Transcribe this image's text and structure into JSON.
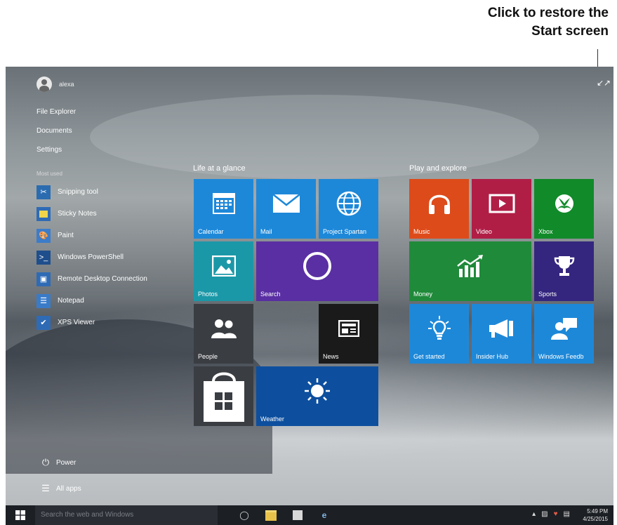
{
  "annotation": {
    "line1": "Click to restore the",
    "line2": "Start screen"
  },
  "user": {
    "name": "alexa"
  },
  "places": [
    {
      "label": "File Explorer"
    },
    {
      "label": "Documents"
    },
    {
      "label": "Settings"
    }
  ],
  "most_used_label": "Most used",
  "apps": [
    {
      "label": "Snipping tool",
      "icon": "scissors-icon",
      "color": "#2b6cb0"
    },
    {
      "label": "Sticky Notes",
      "icon": "note-icon",
      "color": "#d8b62c"
    },
    {
      "label": "Paint",
      "icon": "paint-icon",
      "color": "#3d7cc9"
    },
    {
      "label": "Windows PowerShell",
      "icon": "powershell-icon",
      "color": "#1f4e8c"
    },
    {
      "label": "Remote Desktop Connection",
      "icon": "remote-icon",
      "color": "#2f6bb5"
    },
    {
      "label": "Notepad",
      "icon": "notepad-icon",
      "color": "#3a7bc8"
    },
    {
      "label": "XPS Viewer",
      "icon": "xps-icon",
      "color": "#2f6bb5"
    }
  ],
  "power_label": "Power",
  "all_apps_label": "All apps",
  "groups": {
    "life": "Life at a glance",
    "play": "Play and explore"
  },
  "tiles": {
    "calendar": "Calendar",
    "mail": "Mail",
    "spartan": "Project Spartan",
    "photos": "Photos",
    "search": "Search",
    "people": "People",
    "news": "News",
    "weather": "Weather",
    "music": "Music",
    "video": "Video",
    "xbox": "Xbox",
    "money": "Money",
    "sports": "Sports",
    "getstarted": "Get started",
    "insider": "Insider Hub",
    "feedback": "Windows Feedb"
  },
  "colors": {
    "blue": "#1e88d8",
    "teal": "#1b98a8",
    "purple": "#5a2fa3",
    "darkgray": "#3a3d42",
    "black": "#1a1a1a",
    "navy": "#0d4f9e",
    "orange": "#dd4b1a",
    "crimson": "#b01e46",
    "green": "#118a2a",
    "money_green": "#1f8a3a",
    "indigo": "#34267e"
  },
  "taskbar": {
    "search_placeholder": "Search the web and Windows",
    "time": "5:49 PM",
    "date": "4/25/2015"
  }
}
